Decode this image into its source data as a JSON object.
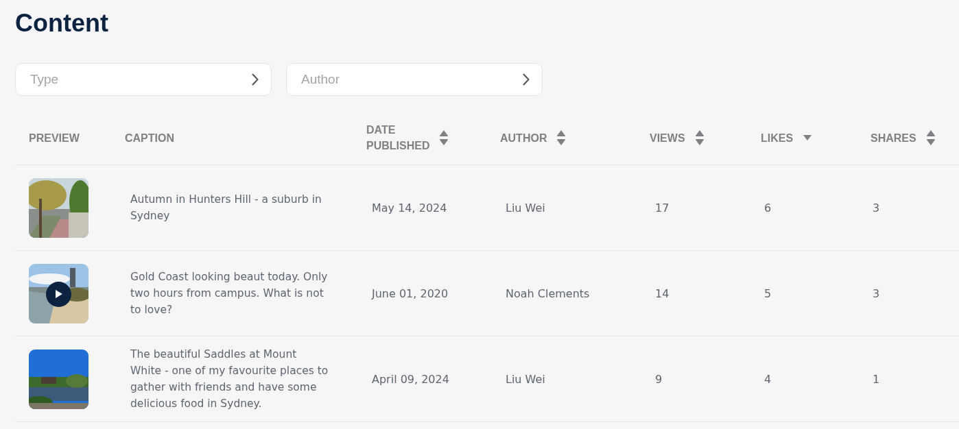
{
  "title": "Content",
  "filters": [
    {
      "placeholder": "Type"
    },
    {
      "placeholder": "Author"
    }
  ],
  "columns": [
    {
      "label": "PREVIEW",
      "sortable": false,
      "sorted_descending": false
    },
    {
      "label": "CAPTION",
      "sortable": false,
      "sorted_descending": false
    },
    {
      "label": "DATE PUBLISHED",
      "sortable": true,
      "sorted_descending": false
    },
    {
      "label": "AUTHOR",
      "sortable": true,
      "sorted_descending": false
    },
    {
      "label": "VIEWS",
      "sortable": true,
      "sorted_descending": false
    },
    {
      "label": "LIKES",
      "sortable": true,
      "sorted_descending": true
    },
    {
      "label": "SHARES",
      "sortable": true,
      "sorted_descending": false
    }
  ],
  "rows": [
    {
      "caption": "Autumn in Hunters Hill - a suburb in Sydney",
      "date": "May 14, 2024",
      "author": "Liu Wei",
      "views": "17",
      "likes": "6",
      "shares": "3"
    },
    {
      "preview": {
        "kind": "video"
      },
      "caption": "Gold Coast looking beaut today. Only two hours from campus. What is not to love?",
      "date": "June 01, 2020",
      "author": "Noah Clements",
      "views": "14",
      "likes": "5",
      "shares": "3"
    },
    {
      "caption": "The beautiful Saddles at Mount White - one of my favourite places to gather with friends and have some delicious food in Sydney.",
      "date": "April 09, 2024",
      "author": "Liu Wei",
      "views": "9",
      "likes": "4",
      "shares": "1"
    }
  ]
}
